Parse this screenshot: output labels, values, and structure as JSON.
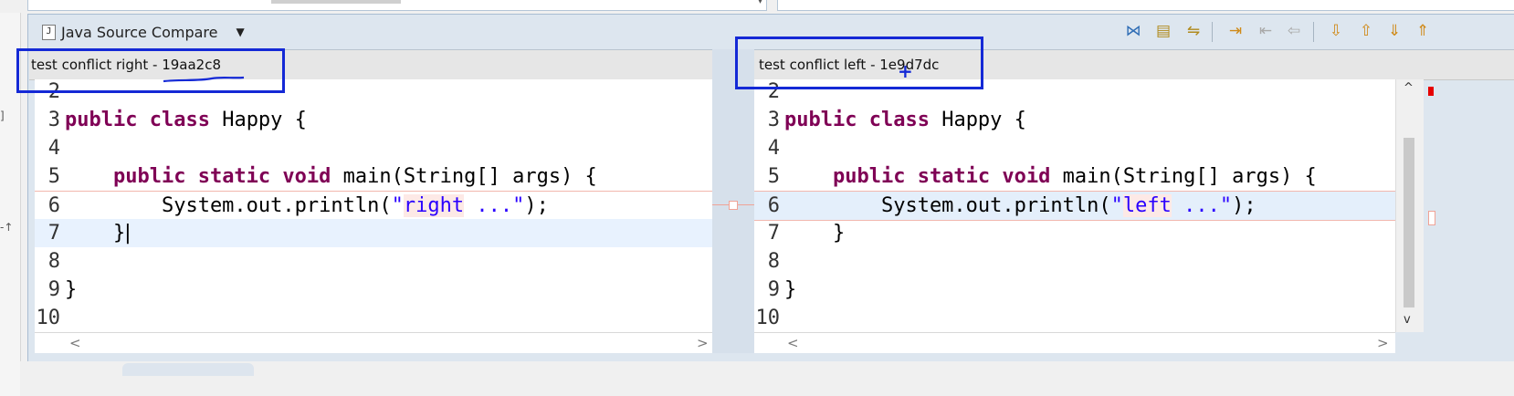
{
  "viewer": {
    "title": "Java Source Compare",
    "dropdown": "▼",
    "icon": "J"
  },
  "left_pane": {
    "header": "test conflict right - 19aa2c8",
    "lines": [
      {
        "num": "2",
        "segments": []
      },
      {
        "num": "3",
        "segments": [
          {
            "text": "public class",
            "kind": "kw"
          },
          {
            "text": " Happy {",
            "kind": "plain"
          }
        ]
      },
      {
        "num": "4",
        "segments": []
      },
      {
        "num": "5",
        "segments": [
          {
            "text": "    ",
            "kind": "plain"
          },
          {
            "text": "public static void",
            "kind": "kw"
          },
          {
            "text": " main(String[] args) {",
            "kind": "plain"
          }
        ]
      },
      {
        "num": "6",
        "segments": [
          {
            "text": "        System.out.println(",
            "kind": "plain"
          },
          {
            "text": "\"",
            "kind": "str"
          },
          {
            "text": "right",
            "kind": "str-diff"
          },
          {
            "text": " ...\"",
            "kind": "str"
          },
          {
            "text": ");",
            "kind": "plain"
          }
        ],
        "style": "diff-right"
      },
      {
        "num": "7",
        "segments": [
          {
            "text": "    }",
            "kind": "plain"
          },
          {
            "text": "|",
            "kind": "caret"
          }
        ],
        "style": "current"
      },
      {
        "num": "8",
        "segments": []
      },
      {
        "num": "9",
        "segments": [
          {
            "text": "}",
            "kind": "plain"
          }
        ]
      },
      {
        "num": "10",
        "segments": []
      }
    ]
  },
  "right_pane": {
    "header": "test conflict left - 1e9d7dc",
    "lines": [
      {
        "num": "2",
        "segments": []
      },
      {
        "num": "3",
        "segments": [
          {
            "text": "public class",
            "kind": "kw"
          },
          {
            "text": " Happy {",
            "kind": "plain"
          }
        ]
      },
      {
        "num": "4",
        "segments": []
      },
      {
        "num": "5",
        "segments": [
          {
            "text": "    ",
            "kind": "plain"
          },
          {
            "text": "public static void",
            "kind": "kw"
          },
          {
            "text": " main(String[] args) {",
            "kind": "plain"
          }
        ]
      },
      {
        "num": "6",
        "segments": [
          {
            "text": "        System.out.println(",
            "kind": "plain"
          },
          {
            "text": "\"",
            "kind": "str"
          },
          {
            "text": "left",
            "kind": "str-diff"
          },
          {
            "text": " ...\"",
            "kind": "str"
          },
          {
            "text": ");",
            "kind": "plain"
          }
        ],
        "style": "diff-left"
      },
      {
        "num": "7",
        "segments": [
          {
            "text": "    }",
            "kind": "plain"
          }
        ]
      },
      {
        "num": "8",
        "segments": []
      },
      {
        "num": "9",
        "segments": [
          {
            "text": "}",
            "kind": "plain"
          }
        ]
      },
      {
        "num": "10",
        "segments": []
      }
    ]
  },
  "scroll": {
    "left_arrow": "<",
    "right_arrow": ">",
    "up_arrow": "^",
    "down_arrow": "v"
  },
  "toolbar_icons": [
    {
      "name": "ignore-whitespace-icon",
      "glyph": "⋈",
      "color": "#2f6db5"
    },
    {
      "name": "show-ancestor-pane-icon",
      "glyph": "▤",
      "color": "#b08a1c"
    },
    {
      "name": "show-ancestor-icon",
      "glyph": "⇋",
      "color": "#b08a1c"
    },
    {
      "name": "copy-left-to-right-icon",
      "glyph": "⇥",
      "color": "#d08a18"
    },
    {
      "name": "copy-right-to-left-icon",
      "glyph": "⇤",
      "color": "#a9a9a9"
    },
    {
      "name": "copy-all-icon",
      "glyph": "⇦",
      "color": "#a9a9a9"
    },
    {
      "name": "next-difference-icon",
      "glyph": "⇩",
      "color": "#d08a18"
    },
    {
      "name": "previous-difference-icon",
      "glyph": "⇧",
      "color": "#d08a18"
    },
    {
      "name": "next-change-icon",
      "glyph": "⇓",
      "color": "#d08a18"
    },
    {
      "name": "previous-change-icon",
      "glyph": "⇑",
      "color": "#d08a18"
    }
  ]
}
